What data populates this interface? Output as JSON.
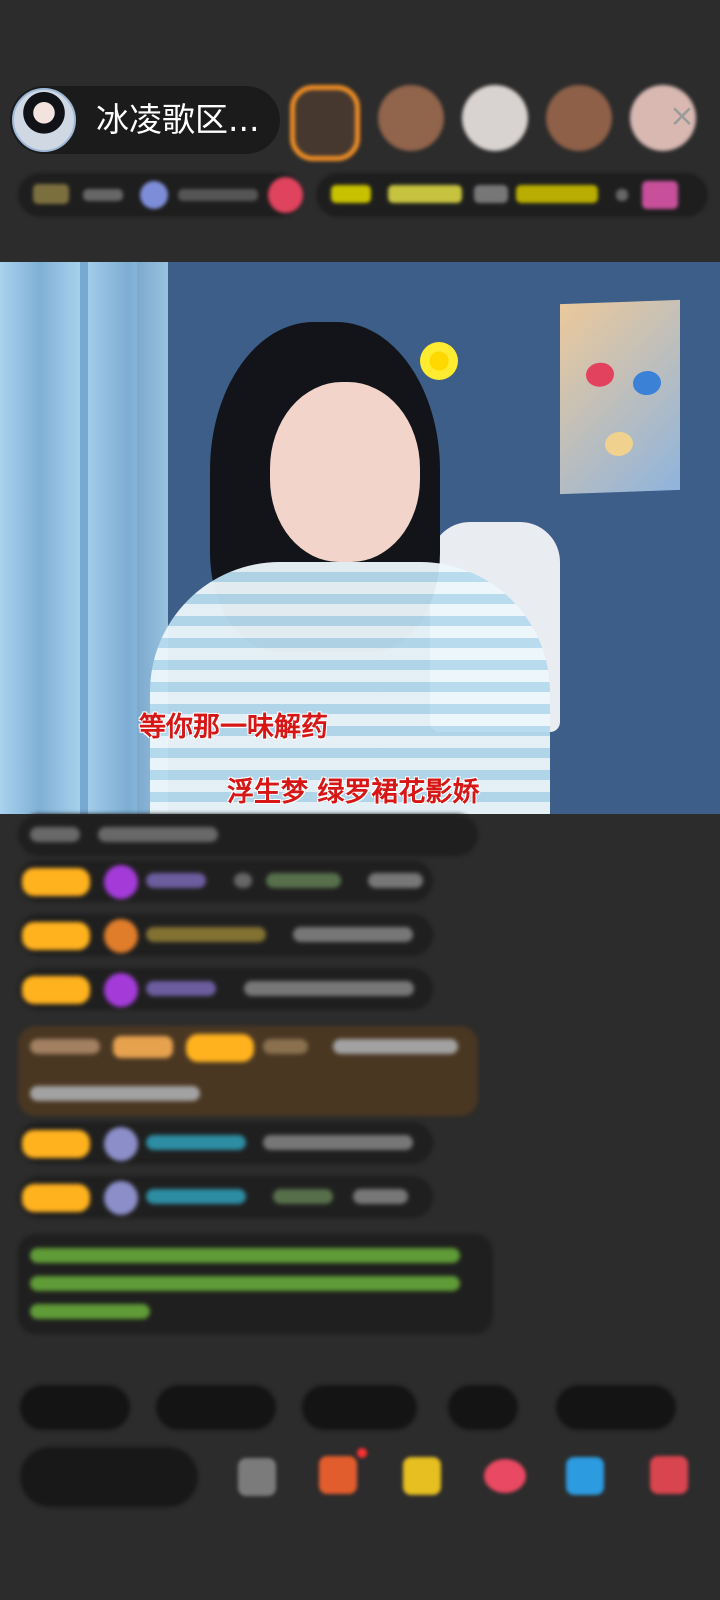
{
  "host": {
    "name": "冰凌歌区..."
  },
  "lyrics": {
    "line_one": "等你那一味解药",
    "line_two": "浮生梦  绿罗裙花影娇"
  },
  "header": {
    "close_icon": "close-icon",
    "viewer_count_visible": 5
  },
  "colors": {
    "background": "#2c2c2c",
    "panel": "#1b1b1b",
    "badge": "#ffb21e",
    "lyric": "#d71616",
    "lyric_outline": "#ffffff"
  }
}
